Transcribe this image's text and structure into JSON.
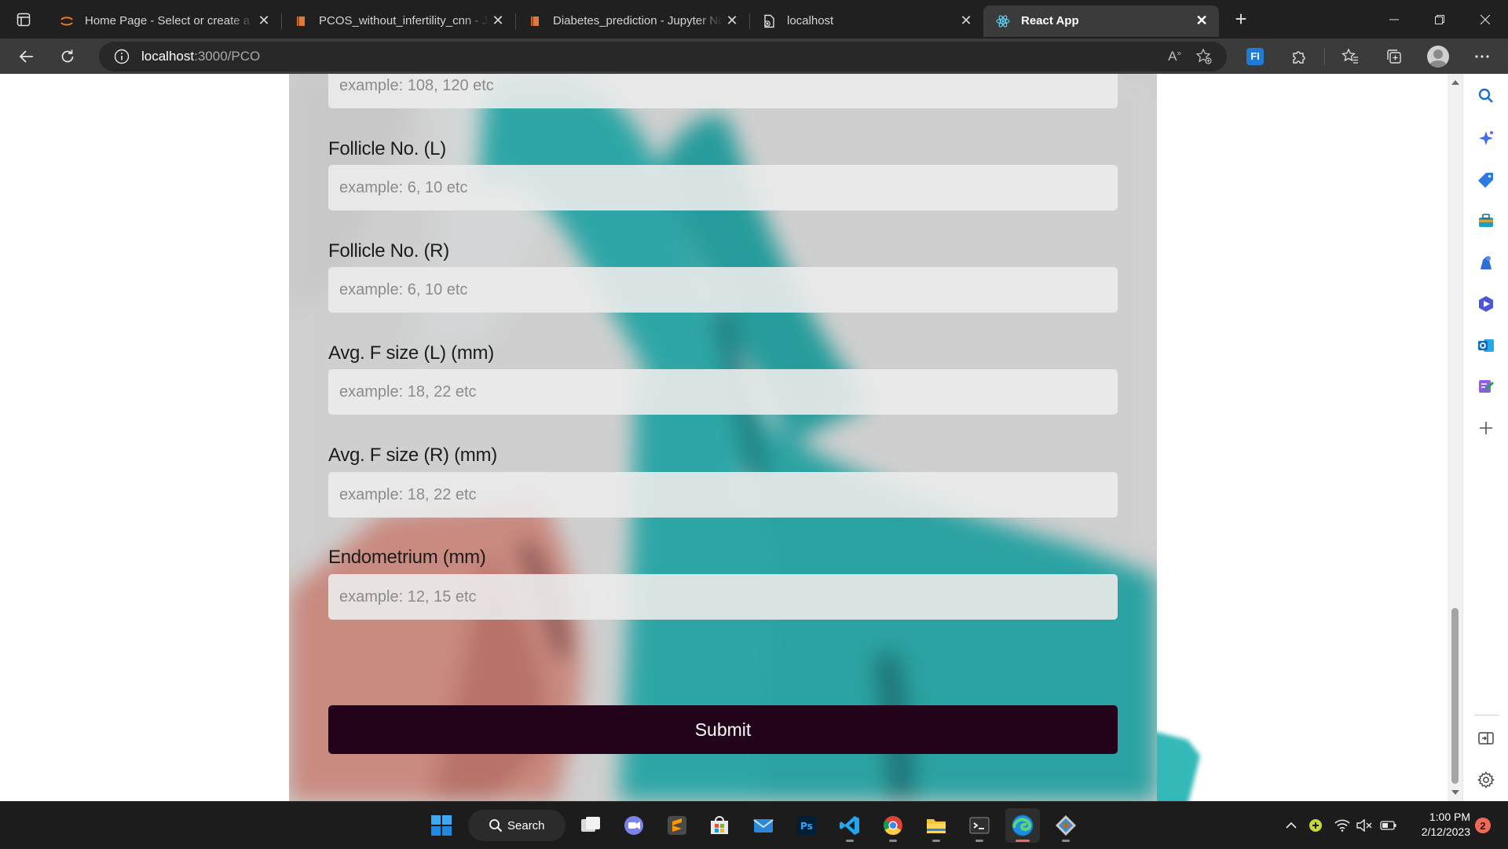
{
  "browser": {
    "tabs": [
      {
        "title": "Home Page - Select or create a notebook",
        "icon": "jupyter-icon"
      },
      {
        "title": "PCOS_without_infertility_cnn - Jupyter Notebook",
        "icon": "notebook-icon"
      },
      {
        "title": "Diabetes_prediction - Jupyter Notebook",
        "icon": "notebook-icon"
      },
      {
        "title": "localhost",
        "icon": "page-error-icon"
      },
      {
        "title": "React App",
        "icon": "react-icon",
        "active": true
      }
    ],
    "url_host": "localhost",
    "url_rest": ":3000/PCO",
    "accent": "#3b3b3b"
  },
  "form": {
    "partial_placeholder": "example: 108, 120 etc",
    "fields": [
      {
        "label": "Follicle No. (L)",
        "placeholder": "example: 6, 10 etc"
      },
      {
        "label": "Follicle No. (R)",
        "placeholder": "example: 6, 10 etc"
      },
      {
        "label": "Avg. F size (L) (mm)",
        "placeholder": "example: 18, 22 etc"
      },
      {
        "label": "Avg. F size (R) (mm)",
        "placeholder": "example: 18, 22 etc"
      },
      {
        "label": "Endometrium (mm)",
        "placeholder": "example: 12, 15 etc"
      }
    ],
    "submit_label": "Submit",
    "submit_color": "#22031a",
    "card_color": "#cfcfcf",
    "art_colors": {
      "teal": "#2ea6a6",
      "salmon": "#c98a80"
    }
  },
  "sidebar_icons": [
    "search-icon",
    "copilot-icon",
    "shopping-tag-icon",
    "tools-icon",
    "games-icon",
    "microsoft-365-icon",
    "outlook-icon",
    "drop-icon",
    "add-icon",
    "split-screen-icon",
    "settings-icon"
  ],
  "taskbar": {
    "search_label": "Search",
    "apps": [
      "windows-start-icon",
      "task-view-icon",
      "teams-chat-icon",
      "sublime-text-icon",
      "microsoft-store-icon",
      "mail-icon",
      "photoshop-icon",
      "vscode-icon",
      "chrome-icon",
      "file-explorer-icon",
      "terminal-icon",
      "edge-icon",
      "git-icon"
    ],
    "time": "1:00 PM",
    "date": "2/12/2023",
    "notifications": "2"
  }
}
